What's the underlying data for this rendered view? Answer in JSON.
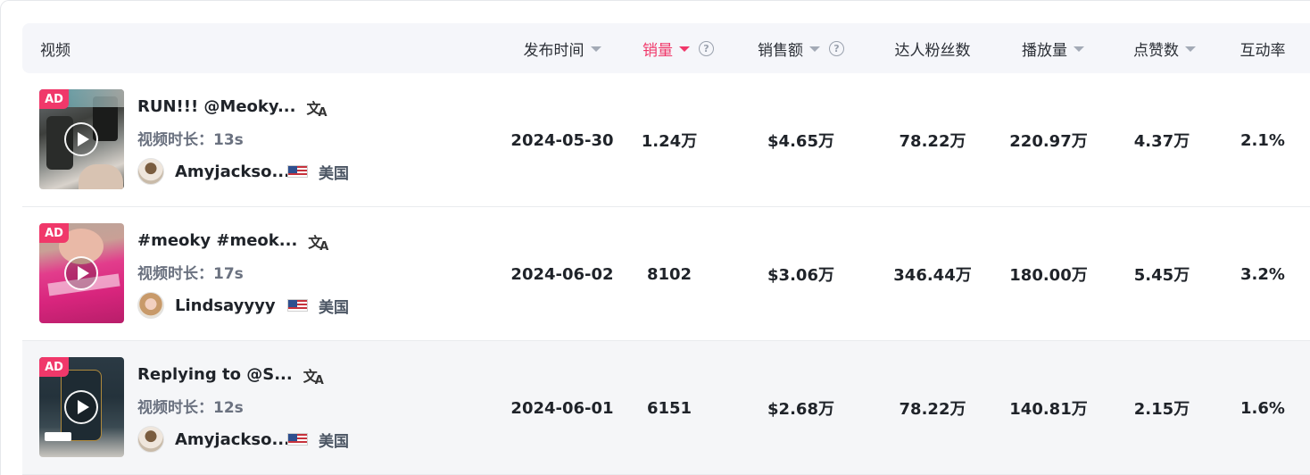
{
  "header": {
    "video": "视频",
    "publish_time": "发布时间",
    "sales": "销量",
    "sales_amount": "销售额",
    "followers": "达人粉丝数",
    "plays": "播放量",
    "likes": "点赞数",
    "engagement": "互动率"
  },
  "colors": {
    "accent": "#f0386a",
    "header_bg": "#f5f6fa",
    "hover_row_bg": "#f5f6f8"
  },
  "rows": [
    {
      "badge": "AD",
      "title": "RUN!!! @Meoky...",
      "duration": "视频时长：13s",
      "creator": "Amyjackso...",
      "country": "美国",
      "publish_date": "2024-05-30",
      "sales": "1.24万",
      "sales_amount": "$4.65万",
      "followers": "78.22万",
      "plays": "220.97万",
      "likes": "4.37万",
      "engagement": "2.1%"
    },
    {
      "badge": "AD",
      "title": "#meoky #meok...",
      "duration": "视频时长：17s",
      "creator": "Lindsayyyy",
      "country": "美国",
      "publish_date": "2024-06-02",
      "sales": "8102",
      "sales_amount": "$3.06万",
      "followers": "346.44万",
      "plays": "180.00万",
      "likes": "5.45万",
      "engagement": "3.2%"
    },
    {
      "badge": "AD",
      "title": "Replying to @S...",
      "duration": "视频时长：12s",
      "creator": "Amyjackso...",
      "country": "美国",
      "publish_date": "2024-06-01",
      "sales": "6151",
      "sales_amount": "$2.68万",
      "followers": "78.22万",
      "plays": "140.81万",
      "likes": "2.15万",
      "engagement": "1.6%"
    }
  ]
}
